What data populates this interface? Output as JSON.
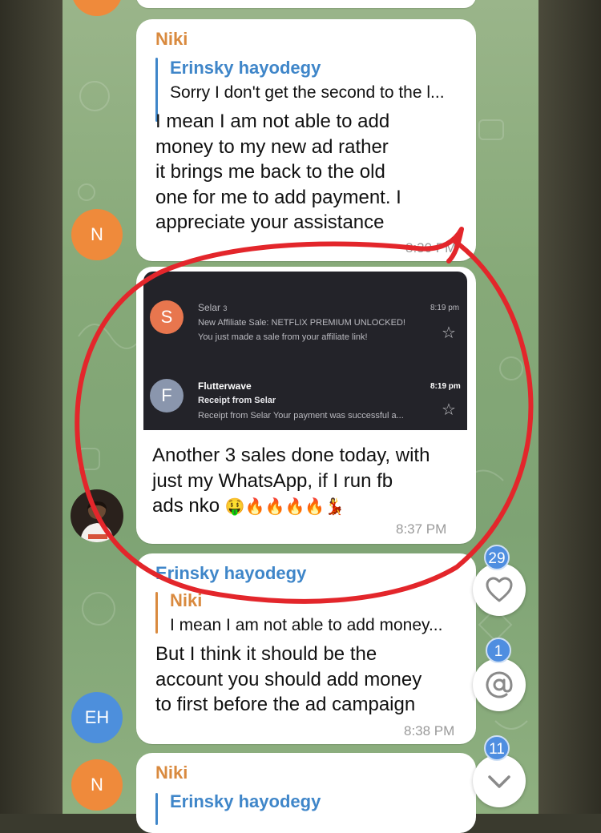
{
  "colors": {
    "accent_blue": "#3f86c9",
    "name_orange": "#d98a3f",
    "bubble_bg": "#ffffff",
    "annotation_red": "#e3262b",
    "badge_blue": "#4f8ee0"
  },
  "avatars": {
    "niki_initial": "N",
    "erinsky_initials": "EH"
  },
  "messages": [
    {
      "sender": "Niki",
      "reply_to": {
        "name": "Erinsky hayodegy",
        "text": "Sorry I don't get the second to the l..."
      },
      "lines": [
        "I mean I am not able to add",
        "money to my new ad rather",
        "it brings me back to the old",
        "one for me to add payment. I",
        "appreciate your assistance"
      ],
      "time": "8:30 PM"
    },
    {
      "embed": {
        "emails": [
          {
            "avatar_letter": "S",
            "from": "Selar",
            "count": "3",
            "subject": "New Affiliate Sale: NETFLIX PREMIUM UNLOCKED!",
            "snippet": "You just made a sale from your affiliate link!",
            "time": "8:19 pm"
          },
          {
            "avatar_letter": "F",
            "from": "Flutterwave",
            "subject": "Receipt from Selar",
            "snippet": "Receipt from Selar Your payment was successful a...",
            "time": "8:19 pm"
          }
        ]
      },
      "lines": [
        "Another 3 sales done today, with",
        "just my  WhatsApp, if I run fb",
        "ads nko"
      ],
      "emojis": "🤑🔥🔥🔥🔥💃",
      "time": "8:37 PM"
    },
    {
      "sender": "Erinsky hayodegy",
      "reply_to": {
        "name": "Niki",
        "text": "I mean I am not able to add money..."
      },
      "lines": [
        "But I think it should be the",
        "account you should add  money",
        "to first before the ad campaign"
      ],
      "time": "8:38 PM"
    },
    {
      "sender": "Niki",
      "reply_to": {
        "name": "Erinsky hayodegy"
      }
    }
  ],
  "floating_buttons": {
    "reactions_count": "29",
    "mentions_count": "1",
    "unread_count": "11"
  },
  "icons": [
    "heart-icon",
    "at-icon",
    "chevron-down-icon",
    "fire-emoji",
    "money-mouth-emoji",
    "dancer-emoji",
    "star-icon"
  ]
}
